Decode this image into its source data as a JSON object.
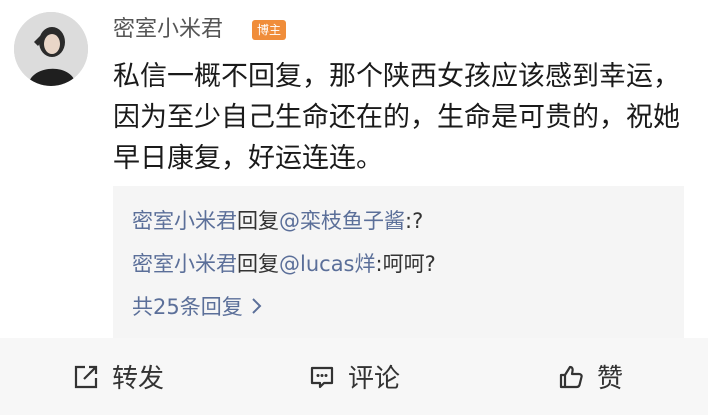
{
  "post": {
    "username": "密室小米君",
    "badge": "博主",
    "body": "私信一概不回复，那个陕西女孩应该感到幸运，因为至少自己生命还在的，生命是可贵的，祝她早日康复，好运连连。"
  },
  "replies": {
    "items": [
      {
        "author": "密室小米君",
        "verb": "回复",
        "target": "@栾枝鱼子酱",
        "text": ":?"
      },
      {
        "author": "密室小米君",
        "verb": "回复",
        "target": "@lucas烊",
        "text": ":呵呵?"
      }
    ],
    "more_label": "共25条回复"
  },
  "actions": {
    "forward": "转发",
    "comment": "评论",
    "like": "赞"
  },
  "icons": [
    "share-icon",
    "comment-icon",
    "thumbs-up-icon",
    "chevron-right-icon"
  ],
  "colors": {
    "badge": "#f08d3a",
    "link": "#5b6f99",
    "reply_bg": "#f5f5f5"
  }
}
